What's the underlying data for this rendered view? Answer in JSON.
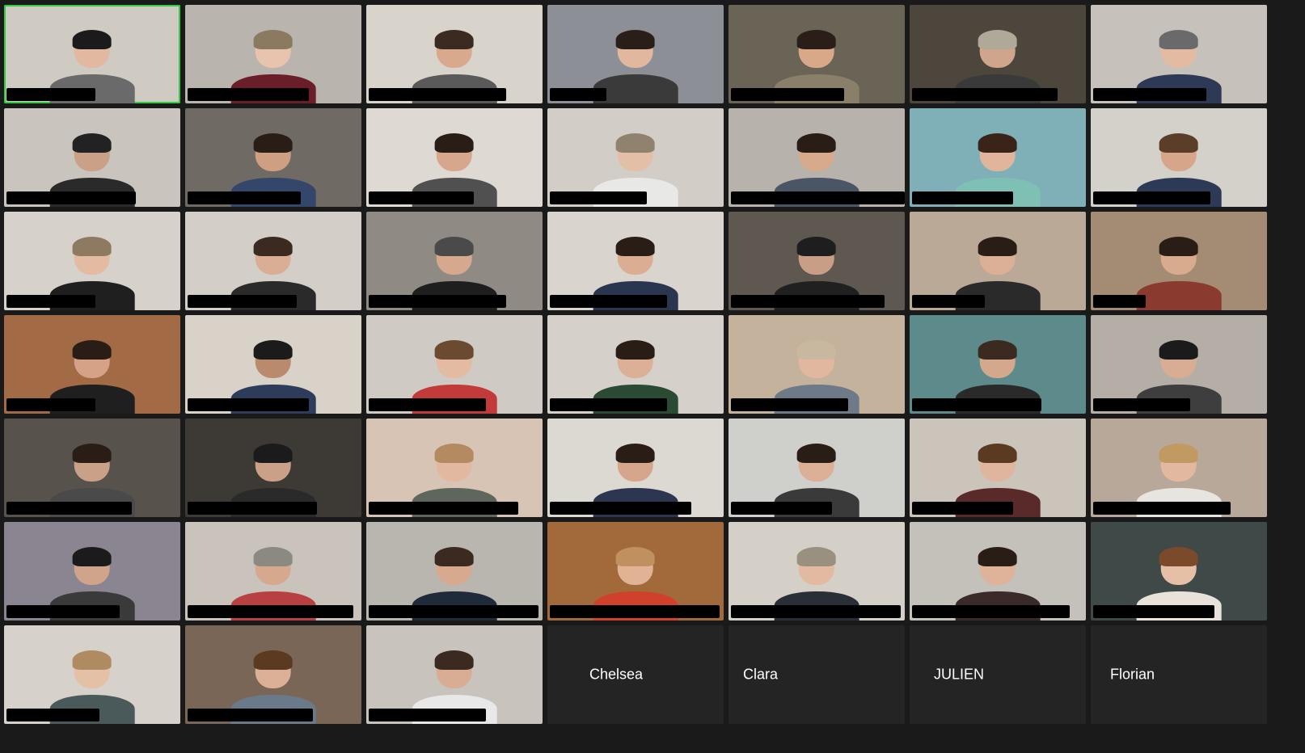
{
  "app": {
    "accent_active": "#2ecc40",
    "background": "#1a1a1a"
  },
  "participants": [
    {
      "bg": "#cfcac2",
      "skin": "#e2b8a0",
      "shirt": "#6a6a6a",
      "hair": "#1b1b1b",
      "bar": 110,
      "active": true
    },
    {
      "bg": "#b9b4ad",
      "skin": "#e8c3ad",
      "shirt": "#6b1e2a",
      "hair": "#8a7a60",
      "bar": 150
    },
    {
      "bg": "#d8d3cb",
      "skin": "#d9a98e",
      "shirt": "#5a5a5a",
      "hair": "#3a2a20",
      "bar": 170
    },
    {
      "bg": "#8d8f96",
      "skin": "#e1b79e",
      "shirt": "#3a3a3a",
      "hair": "#2a1e18",
      "bar": 70
    },
    {
      "bg": "#6a6456",
      "skin": "#d8a889",
      "shirt": "#8a7f6a",
      "hair": "#2a1e18",
      "bar": 140
    },
    {
      "bg": "#4c463c",
      "skin": "#cfa68c",
      "shirt": "#3a3a3a",
      "hair": "#b0a898",
      "bar": 180
    },
    {
      "bg": "#c7c1bb",
      "skin": "#e3bba2",
      "shirt": "#2e3a55",
      "hair": "#6a6a6a",
      "bar": 140
    },
    {
      "bg": "#c9c4bd",
      "skin": "#caa087",
      "shirt": "#2a2a2a",
      "hair": "#222222",
      "bar": 160
    },
    {
      "bg": "#6f6a63",
      "skin": "#cf9f82",
      "shirt": "#34476b",
      "hair": "#2a1d15",
      "bar": 140
    },
    {
      "bg": "#dedad3",
      "skin": "#d7a78d",
      "shirt": "#505050",
      "hair": "#2a1d15",
      "bar": 130
    },
    {
      "bg": "#d2cdc6",
      "skin": "#e3bfa8",
      "shirt": "#e8e8e6",
      "hair": "#8f8370",
      "bar": 120
    },
    {
      "bg": "#b7b2ab",
      "skin": "#d8aa8c",
      "shirt": "#4a5566",
      "hair": "#2a1d15",
      "bar": 215
    },
    {
      "bg": "#7fb0b7",
      "skin": "#e1b59c",
      "shirt": "#7ec0b4",
      "hair": "#3a241a",
      "bar": 125
    },
    {
      "bg": "#d4d0ca",
      "skin": "#d6a58a",
      "shirt": "#2c3a55",
      "hair": "#5a3e28",
      "bar": 145
    },
    {
      "bg": "#d6d1ca",
      "skin": "#e2bba2",
      "shirt": "#1f1f1f",
      "hair": "#8e7a60",
      "bar": 110
    },
    {
      "bg": "#d3cec7",
      "skin": "#d9ae94",
      "shirt": "#2a2a2a",
      "hair": "#3a2a20",
      "bar": 135
    },
    {
      "bg": "#8f8b84",
      "skin": "#d6a98e",
      "shirt": "#1e1e1e",
      "hair": "#4a4a4a",
      "bar": 170
    },
    {
      "bg": "#d9d4cd",
      "skin": "#dbae93",
      "shirt": "#2a3550",
      "hair": "#2a1d15",
      "bar": 145
    },
    {
      "bg": "#5f5851",
      "skin": "#c89f86",
      "shirt": "#202020",
      "hair": "#1e1e1e",
      "bar": 190
    },
    {
      "bg": "#b9a996",
      "skin": "#dcb096",
      "shirt": "#2a2a2a",
      "hair": "#2a1d15",
      "bar": 90
    },
    {
      "bg": "#a38c73",
      "skin": "#d8ab8e",
      "shirt": "#8a3a2e",
      "hair": "#2a1d15",
      "bar": 65
    },
    {
      "bg": "#a26a45",
      "skin": "#d6a287",
      "shirt": "#1f1f1f",
      "hair": "#2a1d15",
      "bar": 110
    },
    {
      "bg": "#d8d2c8",
      "skin": "#b98a6c",
      "shirt": "#2c3c5a",
      "hair": "#1b1b1b",
      "bar": 150
    },
    {
      "bg": "#cfcac3",
      "skin": "#e3bba2",
      "shirt": "#c23a3a",
      "hair": "#6a4a30",
      "bar": 145
    },
    {
      "bg": "#d5d0c9",
      "skin": "#dcb096",
      "shirt": "#2a4a33",
      "hair": "#2a1d15",
      "bar": 145
    },
    {
      "bg": "#c4b29c",
      "skin": "#e1b7a0",
      "shirt": "#6f7a88",
      "hair": "#c8b8a0",
      "bar": 145
    },
    {
      "bg": "#5d8a8a",
      "skin": "#d4a88c",
      "shirt": "#2a2a2a",
      "hair": "#3a2a20",
      "bar": 160
    },
    {
      "bg": "#b4aea7",
      "skin": "#d8ad93",
      "shirt": "#3e3e3e",
      "hair": "#1b1b1b",
      "bar": 120
    },
    {
      "bg": "#58524d",
      "skin": "#c9a088",
      "shirt": "#4a4a4a",
      "hair": "#2a1d15",
      "bar": 155
    },
    {
      "bg": "#3d3934",
      "skin": "#caa088",
      "shirt": "#2a2a2a",
      "hair": "#1b1b1b",
      "bar": 160
    },
    {
      "bg": "#d8c4b5",
      "skin": "#e3b8a0",
      "shirt": "#5e665e",
      "hair": "#b48a60",
      "bar": 185
    },
    {
      "bg": "#dcd8d2",
      "skin": "#d5a68b",
      "shirt": "#2c3650",
      "hair": "#2a1d15",
      "bar": 175
    },
    {
      "bg": "#cfd0cc",
      "skin": "#dbb097",
      "shirt": "#3a3a3a",
      "hair": "#2a1d15",
      "bar": 125
    },
    {
      "bg": "#cbc4bb",
      "skin": "#e0b59e",
      "shirt": "#5a2a2a",
      "hair": "#5a3a20",
      "bar": 125
    },
    {
      "bg": "#b8a89a",
      "skin": "#e2b8a0",
      "shirt": "#e8e5e0",
      "hair": "#c09a60",
      "bar": 170
    },
    {
      "bg": "#8a8590",
      "skin": "#cfa48b",
      "shirt": "#3a3a3a",
      "hair": "#1b1b1b",
      "bar": 140
    },
    {
      "bg": "#c9c3bb",
      "skin": "#d6a98e",
      "shirt": "#b84040",
      "hair": "#8a8a80",
      "bar": 205
    },
    {
      "bg": "#b9b6b0",
      "skin": "#d7aa8f",
      "shirt": "#1f2a3a",
      "hair": "#3a2a20",
      "bar": 210
    },
    {
      "bg": "#a26a3a",
      "skin": "#e2b295",
      "shirt": "#d0402a",
      "hair": "#c09060",
      "bar": 210
    },
    {
      "bg": "#d4cfc7",
      "skin": "#e2b9a1",
      "shirt": "#2a2e36",
      "hair": "#9a9080",
      "bar": 210
    },
    {
      "bg": "#c4c0ba",
      "skin": "#dfb39a",
      "shirt": "#3a2a2a",
      "hair": "#2a1d15",
      "bar": 195
    },
    {
      "bg": "#3f4a48",
      "skin": "#e6c0a6",
      "shirt": "#e8e2da",
      "hair": "#7a4a2a",
      "bar": 150
    },
    {
      "bg": "#d6d1ca",
      "skin": "#e4c0a6",
      "shirt": "#4a5a5a",
      "hair": "#b08a60",
      "bar": 115
    },
    {
      "bg": "#7a6656",
      "skin": "#dcb096",
      "shirt": "#6a7a8a",
      "hair": "#5a3a20",
      "bar": 155
    },
    {
      "bg": "#c8c3bc",
      "skin": "#d9ad93",
      "shirt": "#e8e8e8",
      "hair": "#3a2a20",
      "bar": 145
    }
  ],
  "name_tiles": [
    {
      "label": "Chelsea"
    },
    {
      "label": "Clara"
    },
    {
      "label": "JULIEN"
    },
    {
      "label": "Florian"
    }
  ]
}
